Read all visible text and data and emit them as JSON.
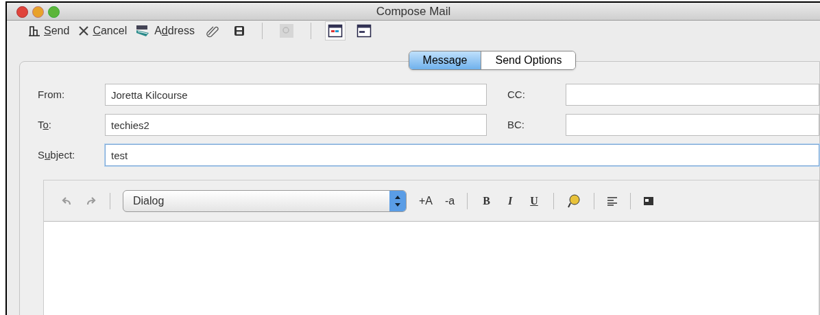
{
  "window": {
    "title": "Compose Mail"
  },
  "toolbar": [
    {
      "kind": "button",
      "label": [
        {
          "text": "S",
          "underlined": true
        },
        {
          "text": "end",
          "underlined": false
        }
      ]
    },
    {
      "kind": "button",
      "label": [
        {
          "text": "C",
          "underlined": true
        },
        {
          "text": "ancel",
          "underlined": false
        }
      ]
    },
    {
      "kind": "button",
      "label": [
        {
          "text": "A",
          "underlined": false
        },
        {
          "text": "d",
          "underlined": true
        },
        {
          "text": "dress",
          "underlined": false
        }
      ]
    },
    {
      "kind": "icon",
      "disabled": false
    },
    {
      "kind": "icon",
      "disabled": false
    },
    {
      "kind": "separator"
    },
    {
      "kind": "icon",
      "disabled": true
    },
    {
      "kind": "separator"
    },
    {
      "kind": "icon",
      "selected": true
    },
    {
      "kind": "icon",
      "selected": false
    }
  ],
  "tabs": [
    {
      "label": "Message",
      "selected": true
    },
    {
      "label": "Send Options",
      "selected": false
    }
  ],
  "fields": [
    {
      "label": [
        {
          "text": "From:",
          "underlined": false
        }
      ],
      "value": "Joretta Kilcourse",
      "side_label": "CC:"
    },
    {
      "label": [
        {
          "text": "T",
          "underlined": false
        },
        {
          "text": "o",
          "underlined": true
        },
        {
          "text": ":",
          "underlined": false
        }
      ],
      "value": "techies2",
      "side_label": "BC:"
    },
    {
      "label": [
        {
          "text": "S",
          "underlined": false
        },
        {
          "text": "u",
          "underlined": true
        },
        {
          "text": "bject:",
          "underlined": false
        }
      ],
      "value": "test",
      "focused": true
    }
  ],
  "editor_toolbar": {
    "font": "Dialog",
    "grow_label": "+A",
    "shrink_label": "-a",
    "bold_label": "B",
    "italic_label": "I",
    "underline_label": "U"
  }
}
